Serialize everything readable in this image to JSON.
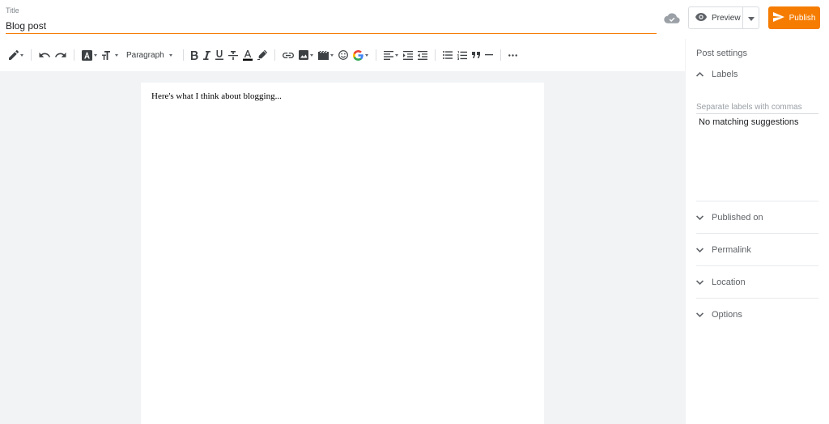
{
  "header": {
    "title_label": "Title",
    "title_value": "Blog post",
    "preview_label": "Preview",
    "publish_label": "Publish"
  },
  "toolbar": {
    "paragraph_label": "Paragraph",
    "text_color_underline": "#000000",
    "icons": [
      "pencil-icon",
      "undo-icon",
      "redo-icon",
      "font-family-icon",
      "font-size-icon",
      "bold-icon",
      "italic-icon",
      "underline-icon",
      "strikethrough-icon",
      "text-color-icon",
      "highlight-icon",
      "link-icon",
      "image-icon",
      "video-icon",
      "emoji-icon",
      "google-icon",
      "align-left-icon",
      "indent-icon",
      "outdent-icon",
      "bulleted-list-icon",
      "numbered-list-icon",
      "quote-icon",
      "horizontal-rule-icon",
      "more-icon"
    ]
  },
  "editor": {
    "body_text": "Here's what I think about blogging..."
  },
  "sidebar": {
    "title": "Post settings",
    "labels": {
      "heading": "Labels",
      "placeholder": "Separate labels with commas",
      "suggestions_text": "No matching suggestions"
    },
    "sections": [
      {
        "label": "Published on"
      },
      {
        "label": "Permalink"
      },
      {
        "label": "Location"
      },
      {
        "label": "Options"
      }
    ]
  },
  "colors": {
    "accent": "#f57c00",
    "editor_background": "#f1f3f4",
    "icon_gray": "#5f6368"
  }
}
